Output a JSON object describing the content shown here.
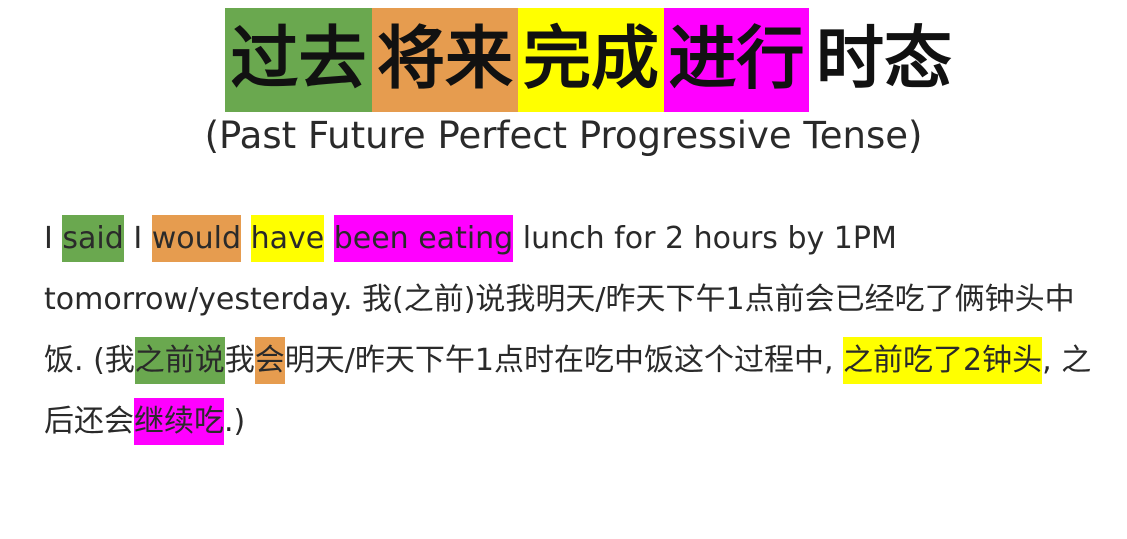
{
  "title": {
    "segments": [
      {
        "text": "过去",
        "color": "#6aa84f"
      },
      {
        "text": "将来",
        "color": "#e69c4f"
      },
      {
        "text": "完成",
        "color": "#ffff00"
      },
      {
        "text": "进行",
        "color": "#ff00ff"
      },
      {
        "text": "时态",
        "color": ""
      }
    ]
  },
  "subtitle": "(Past Future Perfect Progressive Tense)",
  "sentence": {
    "t1": "I ",
    "said": "said",
    "t2": " I ",
    "would": "would",
    "t3": " ",
    "have": "have",
    "t4": " ",
    "been_eating": "been eating",
    "t5": " lunch for 2 hours by 1PM tomorrow/yesterday. 我(之前)说我明天/昨天下午1点前会已经吃了俩钟头中饭. (我",
    "zhiqianshuo": "之前说",
    "t6": "我",
    "hui": "会",
    "t7": "明天/昨天下午1点时在吃中饭这个过程中, ",
    "zhiqian_chile": "之前吃了2钟头",
    "t8": ", 之后还会",
    "jixuchi": "继续吃",
    "t9": ".)"
  },
  "colors": {
    "green": "#6aa84f",
    "orange": "#e69c4f",
    "yellow": "#ffff00",
    "magenta": "#ff00ff"
  }
}
